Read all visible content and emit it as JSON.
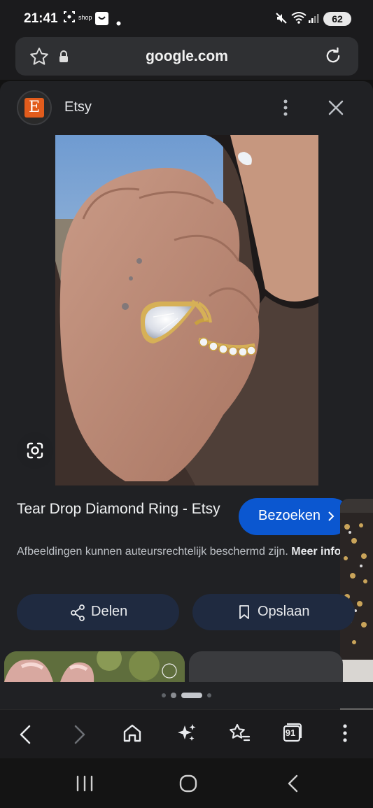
{
  "status_bar": {
    "time": "21:41",
    "notification_label": "shop",
    "battery": "62"
  },
  "address_bar": {
    "url": "google.com"
  },
  "result": {
    "site_name": "Etsy",
    "site_logo_letter": "E",
    "title": "Tear Drop Diamond Ring - Etsy",
    "visit_label": "Bezoeken",
    "copyright_text": "Afbeeldingen kunnen auteursrechtelijk beschermd zijn.",
    "more_info_label": "Meer informatie",
    "share_label": "Delen",
    "save_label": "Opslaan"
  },
  "toolbar": {
    "tabs_count": "91"
  },
  "colors": {
    "accent": "#0b57d0",
    "etsy_orange": "#e25c1c",
    "sheet_bg": "#202124"
  }
}
